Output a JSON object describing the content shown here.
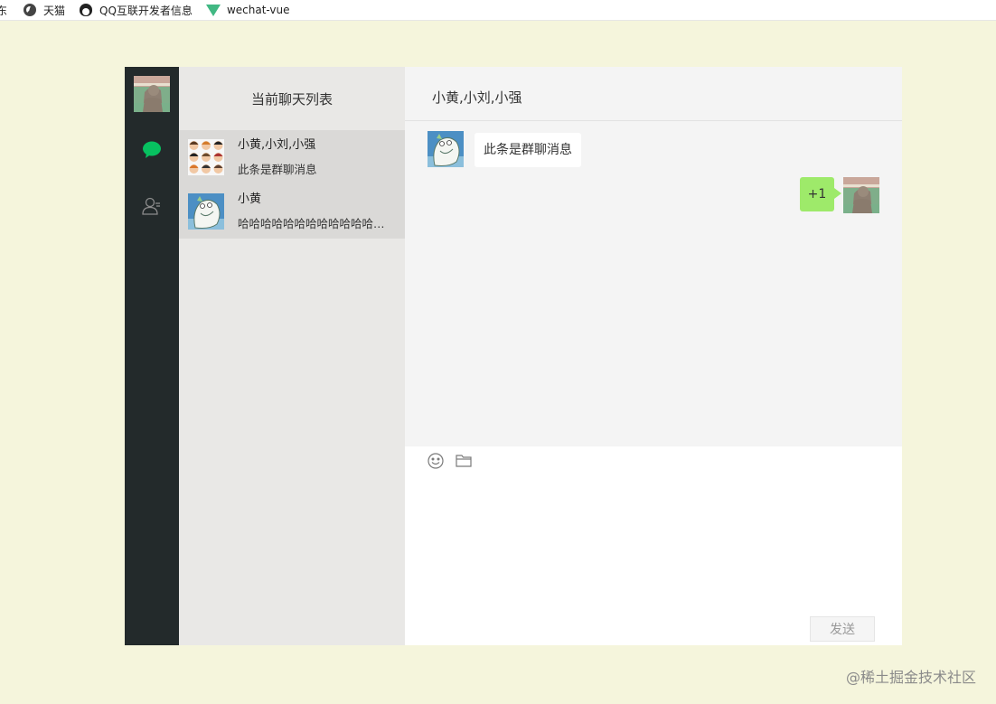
{
  "bookmarks": [
    {
      "label": "东",
      "icon": "none"
    },
    {
      "label": "天猫",
      "icon": "globe-icon"
    },
    {
      "label": "QQ互联开发者信息",
      "icon": "qq-penguin-icon"
    },
    {
      "label": "wechat-vue",
      "icon": "vue-logo-icon"
    }
  ],
  "sidebar": {
    "active_color": "#07c160",
    "inactive_color": "#8c8c8c",
    "items": [
      "chat-bubble-icon",
      "contacts-icon"
    ]
  },
  "list": {
    "title": "当前聊天列表",
    "sessions": [
      {
        "name": "小黄,小刘,小强",
        "last": "此条是群聊消息"
      },
      {
        "name": "小黄",
        "last": "哈哈哈哈哈哈哈哈哈哈哈哈哈哈哈"
      }
    ]
  },
  "chat": {
    "title": "小黄,小刘,小强",
    "messages": [
      {
        "side": "left",
        "text": "此条是群聊消息"
      },
      {
        "side": "right",
        "text": "+1"
      }
    ],
    "tools": [
      "emoji-icon",
      "folder-icon"
    ],
    "send_label": "发送",
    "input_value": ""
  },
  "watermark": "@稀土掘金技术社区",
  "colors": {
    "background": "#f5f5dc",
    "sidebar": "#232a2b",
    "list_panel": "#e9e8e6",
    "chat_bg": "#f4f4f4",
    "bubble_self": "#9eea6a"
  }
}
